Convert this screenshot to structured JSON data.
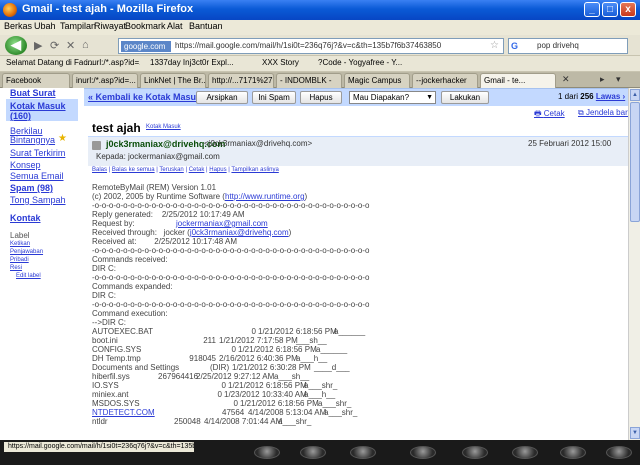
{
  "window": {
    "title": "Gmail - test ajah - Mozilla Firefox",
    "minimize": "_",
    "maximize": "□",
    "close": "x"
  },
  "menu": [
    "Berkas",
    "Ubah",
    "Tampilan",
    "Riwayat",
    "Bookmark",
    "Alat",
    "Bantuan"
  ],
  "nav": {
    "back": "◀",
    "forward": "▶",
    "url_domain": "google.com",
    "url": "https://mail.google.com/mail/h/1si0t=236q76j?&v=c&th=135b7f6b37463850",
    "search_engine": "G",
    "search_text": "pop drivehq"
  },
  "bookmarks": [
    "Selamat Datang di Fac...",
    "inurl:/*.asp?id=...",
    "1337day Inj3ct0r Expl...",
    "XXX Story",
    "?Code - Yogyafree - Y..."
  ],
  "tabs": [
    {
      "label": "Facebook",
      "active": false
    },
    {
      "label": "inurl:/*.asp?id=...",
      "active": false
    },
    {
      "label": "LinkNet | The Br...",
      "active": false
    },
    {
      "label": "http://...7171%27",
      "active": false
    },
    {
      "label": "- INDOMBLK -",
      "active": false
    },
    {
      "label": "Magic Campus",
      "active": false
    },
    {
      "label": "--jockerhacker",
      "active": false
    },
    {
      "label": "Gmail - te...",
      "active": true
    }
  ],
  "sidebar": {
    "compose": "Buat Surat",
    "inbox": "Kotak Masuk (160)",
    "items": [
      "Berkilau",
      "Bintangnya",
      "Surat Terkirim",
      "Konsep",
      "Semua Email",
      "Spam (98)",
      "Tong Sampah"
    ],
    "contacts": "Kontak",
    "labels_title": "Label",
    "labels": [
      "Ketikan",
      "Penjawaban",
      "Pribadi",
      "Resi"
    ],
    "edit_labels": "Edit label"
  },
  "toolbar": {
    "back": "« Kembali ke Kotak Masuk",
    "archive": "Arsipkan",
    "spam": "Ini Spam",
    "delete": "Hapus",
    "more_actions": "Mau Diapakan?",
    "go": "Lakukan",
    "paging_pre": "1",
    "paging_mid": " dari ",
    "paging_total": "256",
    "paging_next": "Lawas ›"
  },
  "print_link": "Cetak",
  "new_window_link": "Jendela baru",
  "subject": "test ajah",
  "inbox_label": "Kotak Masuk",
  "message": {
    "sender_name": "j0ck3rmaniax@drivehq.com",
    "sender_email": "<j0ck3rmaniax@drivehq.com>",
    "date": "25 Februari 2012 15:00",
    "to": "Kepada: jockermaniax@gmail.com",
    "actions": [
      "Balas",
      "Balas ke semua",
      "Teruskan",
      "Cetak",
      "Hapus",
      "Tampilkan aslinya"
    ]
  },
  "body_lines": [
    "RemoteByMail (REM) Version 1.01",
    "(c) 2002, 2005 by Runtime Software (",
    "-o-o-o-o-o-o-o-o-o-o-o-o-o-o-o-o-o-o-o-o-o-o-o-o-o-o-o-o-o-o-o-o-o-o-o-o-o-o-o",
    "Reply generated:    2/25/2012 10:17:49 AM",
    "Request by:",
    "Received through:   jocker (",
    "Received at:        2/25/2012 10:17:48 AM",
    "-o-o-o-o-o-o-o-o-o-o-o-o-o-o-o-o-o-o-o-o-o-o-o-o-o-o-o-o-o-o-o-o-o-o-o-o-o-o-o",
    "Commands received:",
    "DIR C:",
    "-o-o-o-o-o-o-o-o-o-o-o-o-o-o-o-o-o-o-o-o-o-o-o-o-o-o-o-o-o-o-o-o-o-o-o-o-o-o-o",
    "Commands expanded:",
    "DIR C:",
    "-o-o-o-o-o-o-o-o-o-o-o-o-o-o-o-o-o-o-o-o-o-o-o-o-o-o-o-o-o-o-o-o-o-o-o-o-o-o-o",
    "Command execution:",
    "-->DIR C:"
  ],
  "links": {
    "runtime": "http://www.runtime.org",
    "request_email": "jockermaniax@gmail.com",
    "received_email": "j0ck3rmaniax@drivehq.com"
  },
  "files": [
    {
      "name": "AUTOEXEC.BAT",
      "size": "0",
      "date": "1/21/2012 6:18:56 PM",
      "attr": "a______"
    },
    {
      "name": "boot.ini",
      "size": "211",
      "date": "1/21/2012 7:17:58 PM",
      "attr": "___sh__"
    },
    {
      "name": "CONFIG.SYS",
      "size": "0",
      "date": "1/21/2012 6:18:56 PM",
      "attr": "a______"
    },
    {
      "name": "DH Temp.tmp",
      "size": "918045",
      "date": "2/16/2012 6:40:36 PM",
      "attr": "a___h__"
    },
    {
      "name": "Documents and Settings",
      "size": "(DIR)",
      "date": "1/21/2012 6:30:28 PM",
      "attr": "____d___"
    },
    {
      "name": "hiberfil.sys",
      "size": "267964416",
      "date": "2/25/2012 9:27:12 AM",
      "attr": "a___sh__"
    },
    {
      "name": "IO.SYS",
      "size": "0",
      "date": "1/21/2012 6:18:56 PM",
      "attr": "a___shr_"
    },
    {
      "name": "miniex.ant",
      "size": "0",
      "date": "1/23/2012 10:33:40 AM",
      "attr": "a___h__"
    },
    {
      "name": "MSDOS.SYS",
      "size": "0",
      "date": "1/21/2012 6:18:56 PM",
      "attr": "a___shr_"
    },
    {
      "name": "NTDETECT.COM",
      "size": "47564",
      "date": "4/14/2008 5:13:04 AM",
      "attr": "a___shr_"
    },
    {
      "name": "ntldr",
      "size": "250048",
      "date": "4/14/2008 7:01:44 AM",
      "attr": "a___shr_"
    }
  ],
  "status_text": "https://mail.google.com/mail/h/1si0t=236q76j?&v=c&th=135b7f6b37463850"
}
